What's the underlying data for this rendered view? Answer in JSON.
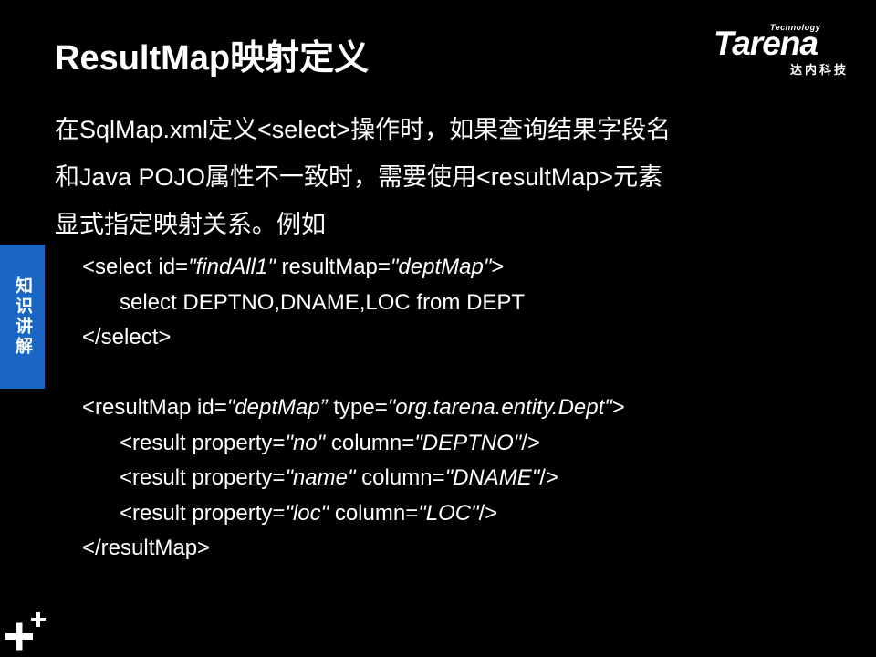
{
  "slide": {
    "title": "ResultMap映射定义",
    "side_tab": "知识讲解",
    "logo": {
      "superscript": "Technology",
      "name": "Tarena",
      "subtitle": "达内科技"
    },
    "intro_lines": [
      "在SqlMap.xml定义<select>操作时，如果查询结果字段名",
      "和Java POJO属性不一致时，需要使用<resultMap>元素",
      "显式指定映射关系。例如"
    ]
  },
  "code": {
    "select_open": {
      "prefix": "<select id=",
      "id_value": "\"findAll1\"",
      "result_map_attr": " resultMap=",
      "result_map_value": "\"deptMap\"",
      "suffix": ">"
    },
    "select_body": "select DEPTNO,DNAME,LOC from DEPT",
    "select_close": "</select>",
    "result_map_open": {
      "prefix": "<resultMap id=",
      "id_value": "\"deptMap”",
      "type_attr": " type=",
      "type_value": "\"org.tarena.entity.Dept\"",
      "suffix": ">"
    },
    "results": [
      {
        "prefix": "<result property=",
        "property_value": "\"no\"",
        "column_attr": " column=",
        "column_value": "\"DEPTNO\"",
        "suffix": "/>"
      },
      {
        "prefix": "<result property=",
        "property_value": "\"name\"",
        "column_attr": " column=",
        "column_value": "\"DNAME\"",
        "suffix": "/>"
      },
      {
        "prefix": "<result property=",
        "property_value": "\"loc\"",
        "column_attr": " column=",
        "column_value": "\"LOC\"",
        "suffix": "/>"
      }
    ],
    "result_map_close": "</resultMap>"
  },
  "colors": {
    "background": "#000000",
    "text": "#ffffff",
    "side_tab": "#1a66c4"
  },
  "icons": {
    "corner": "plus-plus-icon"
  }
}
